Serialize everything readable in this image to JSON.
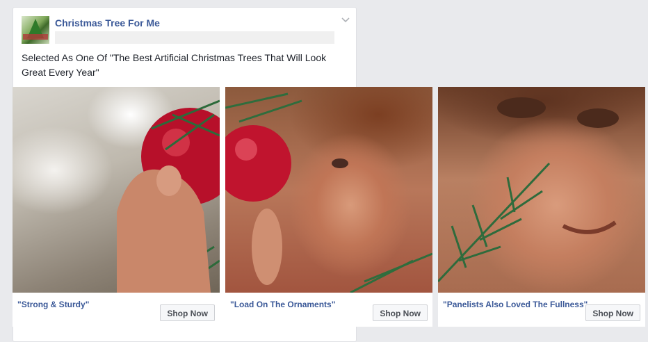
{
  "post": {
    "page_name": "Christmas Tree For Me",
    "text": "Selected As One Of \"The Best Artificial Christmas Trees That Will Look Great Every Year\""
  },
  "carousel": {
    "items": [
      {
        "caption": "\"Strong & Sturdy\"",
        "cta": "Shop Now"
      },
      {
        "caption": "\"Load On The Ornaments\"",
        "cta": "Shop Now"
      },
      {
        "caption": "\"Panelists Also Loved The Fullness\"",
        "cta": "Shop Now"
      }
    ]
  },
  "icons": {
    "menu": "chevron-down-icon",
    "avatar": "page-avatar"
  },
  "colors": {
    "link": "#3b5998",
    "background": "#e9eaed",
    "card": "#ffffff"
  }
}
